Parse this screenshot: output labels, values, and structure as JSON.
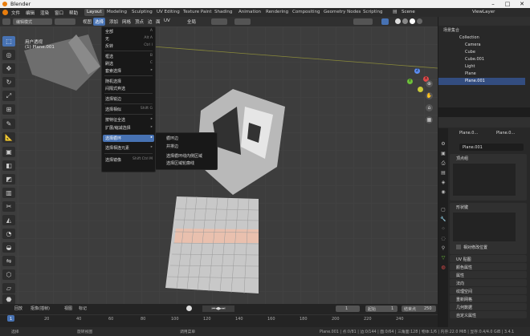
{
  "app": {
    "title": "Blender"
  },
  "window_controls": [
    "–",
    "□",
    "✕"
  ],
  "menubar": {
    "menus": [
      "文件",
      "编辑",
      "渲染",
      "窗口",
      "帮助"
    ],
    "workspaces": [
      "Layout",
      "Modeling",
      "Sculpting",
      "UV Editing",
      "Texture Paint",
      "Shading",
      "Animation",
      "Rendering",
      "Compositing",
      "Geometry Nodes",
      "Scripting"
    ],
    "active_workspace": "Layout",
    "scene_label": "Scene",
    "view_layer_label": "ViewLayer"
  },
  "header": {
    "mode": "编辑模式",
    "items": [
      "视图",
      "选择",
      "添加",
      "网格",
      "顶点",
      "边",
      "面",
      "UV"
    ],
    "transform": "全局"
  },
  "viewport": {
    "info_line1": "用户透视",
    "info_line2": "(1) Plane.001"
  },
  "select_menu": {
    "items": [
      {
        "label": "全部",
        "shortcut": "A"
      },
      {
        "label": "无",
        "shortcut": "Alt A"
      },
      {
        "label": "反转",
        "shortcut": "Ctrl I"
      },
      {
        "label": "框选",
        "shortcut": "B"
      },
      {
        "label": "刷选",
        "shortcut": "C"
      },
      {
        "label": "套索选择",
        "shortcut": "▸"
      },
      {
        "label": "随机选择",
        "shortcut": ""
      },
      {
        "label": "间隔式弃选",
        "shortcut": ""
      },
      {
        "label": "选择锐边",
        "shortcut": ""
      },
      {
        "label": "选择相似",
        "shortcut": "Shift G"
      },
      {
        "label": "按特征全选",
        "shortcut": "▸"
      },
      {
        "label": "扩展/缩减选择",
        "shortcut": "▸"
      },
      {
        "label": "选择循环",
        "shortcut": "▸"
      },
      {
        "label": "选择相连元素",
        "shortcut": "▸"
      },
      {
        "label": "选择镜像",
        "shortcut": "Shift Ctrl M"
      }
    ],
    "highlighted": "选择循环"
  },
  "select_loop_submenu": {
    "items": [
      "循环边",
      "并排边",
      "选择循环线内侧区域",
      "选择区域轮廓线"
    ]
  },
  "outliner": {
    "root": "场景集合",
    "rows": [
      {
        "label": "Collection",
        "color": "#e0e0e0"
      },
      {
        "label": "Camera",
        "color": "#e3a04d"
      },
      {
        "label": "Cube",
        "color": "#e3a04d"
      },
      {
        "label": "Cube.001",
        "color": "#e3a04d"
      },
      {
        "label": "Light",
        "color": "#e3a04d"
      },
      {
        "label": "Plane",
        "color": "#e3a04d"
      },
      {
        "label": "Plane.001",
        "color": "#e3a04d"
      }
    ],
    "selected_row": "Plane.001"
  },
  "properties": {
    "breadcrumb_a": "Plane.0...",
    "breadcrumb_b": "Plane.0...",
    "data_name": "Plane.001",
    "sections": [
      "顶点组",
      "形状键",
      "UV 贴图",
      "颜色属性",
      "属性",
      "法向",
      "纹理空间",
      "重新网格",
      "几何数据",
      "自定义属性"
    ],
    "checkbox_label": "相对修改位置"
  },
  "timeline": {
    "menus": [
      "回放",
      "抠像(插帧)",
      "视图",
      "标记"
    ],
    "current_frame": "1",
    "start_label": "起始",
    "start": "1",
    "end_label": "结束点",
    "end": "250",
    "ticks": [
      "1",
      "20",
      "40",
      "60",
      "80",
      "100",
      "120",
      "140",
      "160",
      "180",
      "200",
      "220",
      "240"
    ]
  },
  "status": {
    "left": "选择",
    "middle": "旋转视图",
    "right_action": "调用菜单",
    "stats": "Plane.001 | 点:0/81 | 边:0/144 | 面:0/64 | 三角面:128 | 物体:1/6 | 内存:22.0 MiB | 显存:0.4/4.0 GiB | 3.4.1"
  },
  "colors": {
    "accent": "#4772b3",
    "stripe": "#e9c0ae"
  }
}
